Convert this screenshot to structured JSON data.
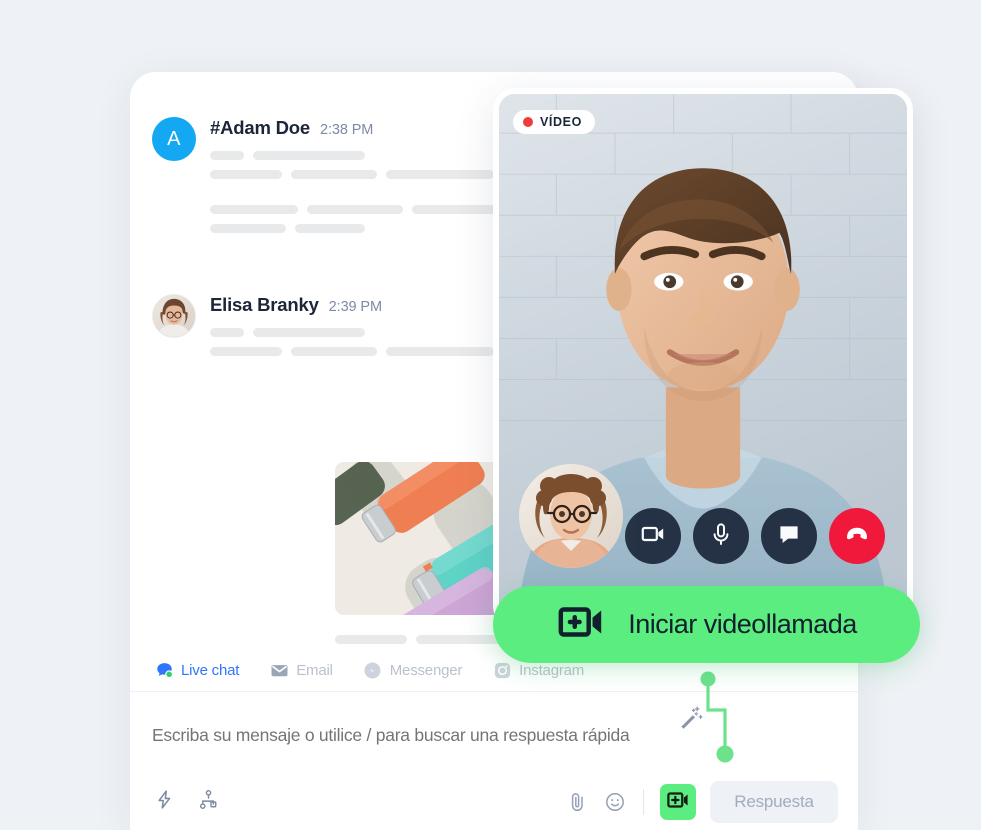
{
  "theme": {
    "page_bg": "#eef1f5",
    "card_bg": "#ffffff",
    "accent_green": "#5ced80",
    "accent_blue": "#2f76ff",
    "rec_red": "#f03c3c",
    "hangup_red": "#f0193c",
    "muted_text": "#b9c1cd",
    "skeleton": "#e8e9ea"
  },
  "messages": [
    {
      "avatar_type": "initial",
      "avatar_initial": "A",
      "avatar_color": "#14a7f2",
      "name": "#Adam Doe",
      "time": "2:38 PM"
    },
    {
      "avatar_type": "photo",
      "avatar_initial": "",
      "name": "Elisa Branky",
      "time": "2:39 PM"
    }
  ],
  "attachment": {
    "alt": "product-photo-water-bottles"
  },
  "channel_tabs": [
    {
      "label": "Live chat",
      "icon": "live-chat-icon",
      "active": true
    },
    {
      "label": "Email",
      "icon": "email-icon",
      "active": false
    },
    {
      "label": "Messenger",
      "icon": "messenger-icon",
      "active": false
    },
    {
      "label": "Instagram",
      "icon": "instagram-icon",
      "active": false
    }
  ],
  "composer": {
    "placeholder": "Escriba su mensaje o utilice / para buscar una respuesta rápida",
    "value": "",
    "magic_icon": "magic-wand-icon",
    "left_tools": [
      {
        "icon": "lightning-bolt-icon",
        "name": "quick-actions"
      },
      {
        "icon": "flow-chart-icon",
        "name": "chatbot-flows"
      }
    ],
    "right_tools": [
      {
        "icon": "paperclip-icon",
        "name": "attach-file"
      },
      {
        "icon": "emoji-icon",
        "name": "insert-emoji"
      }
    ],
    "video_button_icon": "add-video-camera-icon",
    "reply_label": "Respuesta"
  },
  "video": {
    "badge_label": "VÍDEO",
    "badge_icon": "record-dot-icon",
    "self_view_alt": "self-view-webcam",
    "remote_view_alt": "remote-participant-webcam",
    "controls": [
      {
        "icon": "video-camera-icon",
        "name": "toggle-camera",
        "style": "dark"
      },
      {
        "icon": "microphone-icon",
        "name": "toggle-mic",
        "style": "dark"
      },
      {
        "icon": "chat-bubble-icon",
        "name": "toggle-chat",
        "style": "dark"
      },
      {
        "icon": "phone-hangup-icon",
        "name": "end-call",
        "style": "danger"
      }
    ]
  },
  "cta": {
    "label": "Iniciar videollamada",
    "icon": "add-video-camera-icon"
  },
  "skeletons": {
    "adam": [
      [
        34,
        112
      ],
      [
        72,
        86,
        108,
        116,
        102,
        124
      ],
      [
        88,
        96,
        132,
        72,
        84,
        110,
        52
      ],
      [
        76,
        70
      ]
    ],
    "elisa": [
      [
        34,
        112
      ],
      [
        72,
        86,
        108,
        116,
        102,
        124
      ]
    ],
    "after_image": [
      [
        72,
        86,
        108,
        66,
        84,
        110,
        52
      ],
      [
        76,
        70
      ]
    ]
  }
}
